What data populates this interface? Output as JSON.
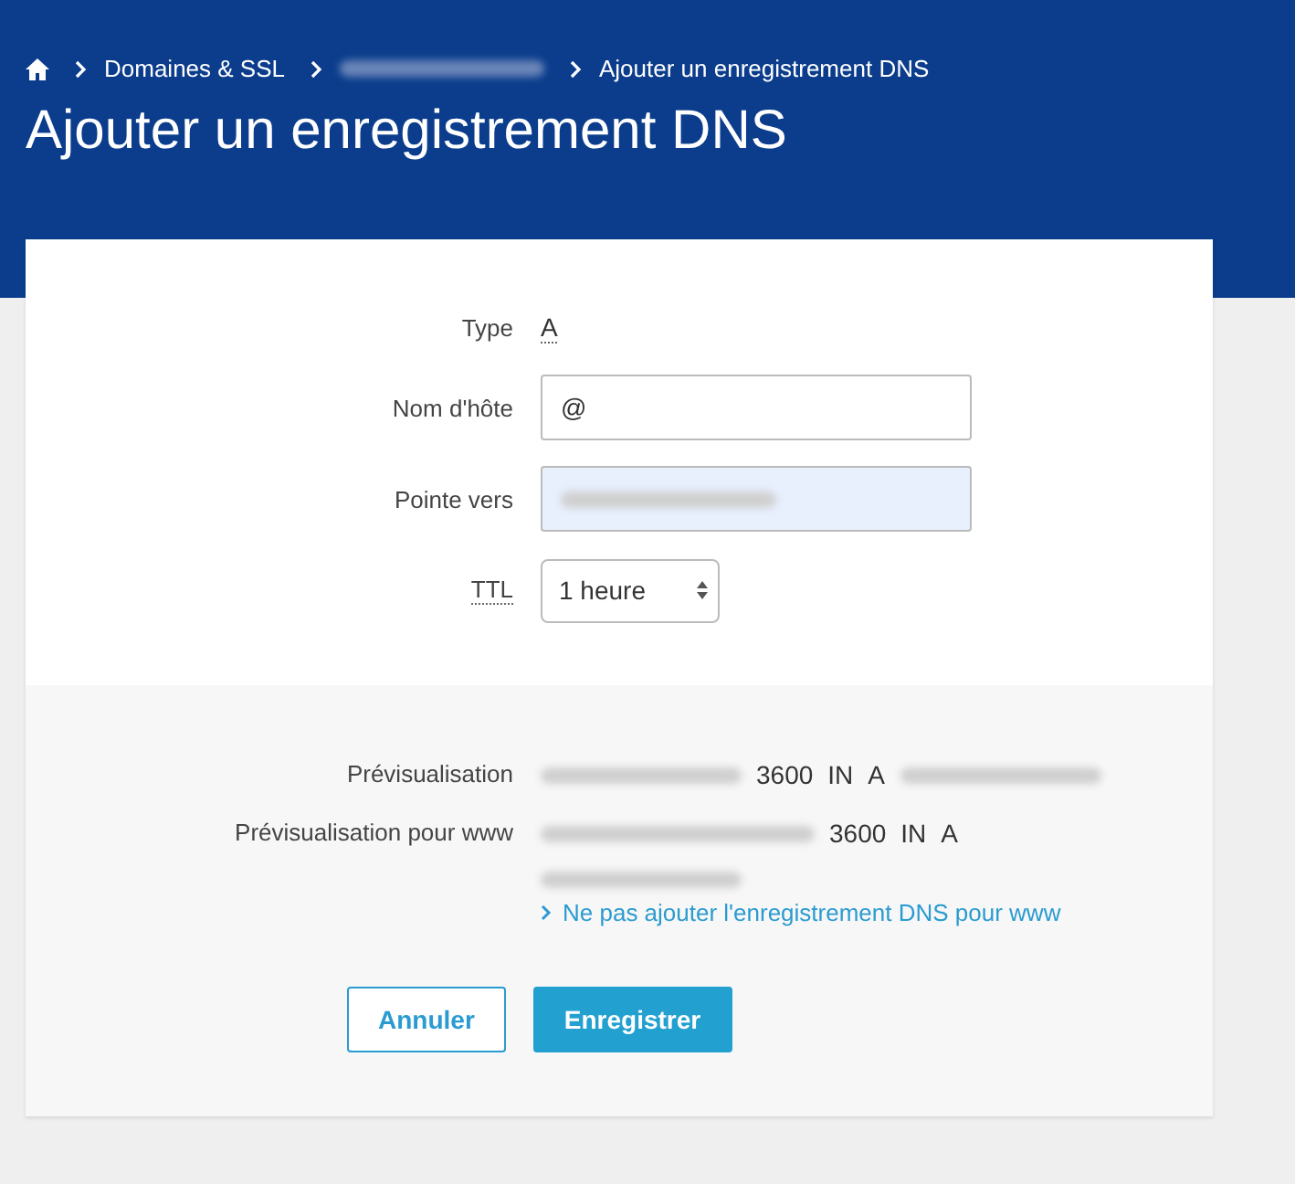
{
  "breadcrumb": [
    {
      "kind": "home"
    },
    {
      "kind": "link",
      "label": "Domaines & SSL"
    },
    {
      "kind": "redacted"
    },
    {
      "kind": "current",
      "label": "Ajouter un enregistrement DNS"
    }
  ],
  "title": "Ajouter un enregistrement DNS",
  "form": {
    "type": {
      "label": "Type",
      "value": "A"
    },
    "hostname": {
      "label": "Nom d'hôte",
      "value": "@"
    },
    "target": {
      "label": "Pointe vers",
      "highlighted": true
    },
    "ttl": {
      "label": "TTL",
      "value": "1 heure"
    }
  },
  "preview": [
    {
      "label": "Prévisualisation",
      "parts": [
        {
          "kind": "redacted"
        },
        {
          "kind": "text",
          "text": "3600"
        },
        {
          "kind": "text",
          "text": "IN"
        },
        {
          "kind": "text",
          "text": "A"
        },
        {
          "kind": "redacted"
        }
      ]
    },
    {
      "label": "Prévisualisation pour www",
      "parts": [
        {
          "kind": "redacted"
        },
        {
          "kind": "text",
          "text": "3600"
        },
        {
          "kind": "text",
          "text": "IN"
        },
        {
          "kind": "text",
          "text": "A"
        },
        {
          "kind": "break"
        },
        {
          "kind": "redacted"
        }
      ]
    }
  ],
  "skip_www_link": "Ne pas ajouter l'enregistrement DNS pour www",
  "buttons": [
    {
      "label": "Annuler",
      "kind": "secondary"
    },
    {
      "label": "Enregistrer",
      "kind": "primary"
    }
  ]
}
